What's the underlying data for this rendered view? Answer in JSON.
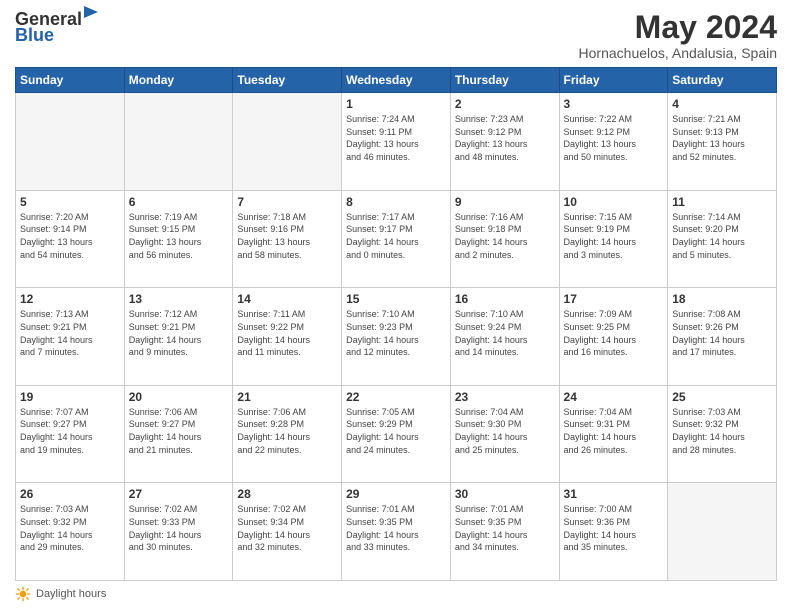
{
  "logo": {
    "general": "General",
    "blue": "Blue"
  },
  "title": "May 2024",
  "location": "Hornachuelos, Andalusia, Spain",
  "days_of_week": [
    "Sunday",
    "Monday",
    "Tuesday",
    "Wednesday",
    "Thursday",
    "Friday",
    "Saturday"
  ],
  "weeks": [
    [
      {
        "day": "",
        "info": ""
      },
      {
        "day": "",
        "info": ""
      },
      {
        "day": "",
        "info": ""
      },
      {
        "day": "1",
        "info": "Sunrise: 7:24 AM\nSunset: 9:11 PM\nDaylight: 13 hours\nand 46 minutes."
      },
      {
        "day": "2",
        "info": "Sunrise: 7:23 AM\nSunset: 9:12 PM\nDaylight: 13 hours\nand 48 minutes."
      },
      {
        "day": "3",
        "info": "Sunrise: 7:22 AM\nSunset: 9:12 PM\nDaylight: 13 hours\nand 50 minutes."
      },
      {
        "day": "4",
        "info": "Sunrise: 7:21 AM\nSunset: 9:13 PM\nDaylight: 13 hours\nand 52 minutes."
      }
    ],
    [
      {
        "day": "5",
        "info": "Sunrise: 7:20 AM\nSunset: 9:14 PM\nDaylight: 13 hours\nand 54 minutes."
      },
      {
        "day": "6",
        "info": "Sunrise: 7:19 AM\nSunset: 9:15 PM\nDaylight: 13 hours\nand 56 minutes."
      },
      {
        "day": "7",
        "info": "Sunrise: 7:18 AM\nSunset: 9:16 PM\nDaylight: 13 hours\nand 58 minutes."
      },
      {
        "day": "8",
        "info": "Sunrise: 7:17 AM\nSunset: 9:17 PM\nDaylight: 14 hours\nand 0 minutes."
      },
      {
        "day": "9",
        "info": "Sunrise: 7:16 AM\nSunset: 9:18 PM\nDaylight: 14 hours\nand 2 minutes."
      },
      {
        "day": "10",
        "info": "Sunrise: 7:15 AM\nSunset: 9:19 PM\nDaylight: 14 hours\nand 3 minutes."
      },
      {
        "day": "11",
        "info": "Sunrise: 7:14 AM\nSunset: 9:20 PM\nDaylight: 14 hours\nand 5 minutes."
      }
    ],
    [
      {
        "day": "12",
        "info": "Sunrise: 7:13 AM\nSunset: 9:21 PM\nDaylight: 14 hours\nand 7 minutes."
      },
      {
        "day": "13",
        "info": "Sunrise: 7:12 AM\nSunset: 9:21 PM\nDaylight: 14 hours\nand 9 minutes."
      },
      {
        "day": "14",
        "info": "Sunrise: 7:11 AM\nSunset: 9:22 PM\nDaylight: 14 hours\nand 11 minutes."
      },
      {
        "day": "15",
        "info": "Sunrise: 7:10 AM\nSunset: 9:23 PM\nDaylight: 14 hours\nand 12 minutes."
      },
      {
        "day": "16",
        "info": "Sunrise: 7:10 AM\nSunset: 9:24 PM\nDaylight: 14 hours\nand 14 minutes."
      },
      {
        "day": "17",
        "info": "Sunrise: 7:09 AM\nSunset: 9:25 PM\nDaylight: 14 hours\nand 16 minutes."
      },
      {
        "day": "18",
        "info": "Sunrise: 7:08 AM\nSunset: 9:26 PM\nDaylight: 14 hours\nand 17 minutes."
      }
    ],
    [
      {
        "day": "19",
        "info": "Sunrise: 7:07 AM\nSunset: 9:27 PM\nDaylight: 14 hours\nand 19 minutes."
      },
      {
        "day": "20",
        "info": "Sunrise: 7:06 AM\nSunset: 9:27 PM\nDaylight: 14 hours\nand 21 minutes."
      },
      {
        "day": "21",
        "info": "Sunrise: 7:06 AM\nSunset: 9:28 PM\nDaylight: 14 hours\nand 22 minutes."
      },
      {
        "day": "22",
        "info": "Sunrise: 7:05 AM\nSunset: 9:29 PM\nDaylight: 14 hours\nand 24 minutes."
      },
      {
        "day": "23",
        "info": "Sunrise: 7:04 AM\nSunset: 9:30 PM\nDaylight: 14 hours\nand 25 minutes."
      },
      {
        "day": "24",
        "info": "Sunrise: 7:04 AM\nSunset: 9:31 PM\nDaylight: 14 hours\nand 26 minutes."
      },
      {
        "day": "25",
        "info": "Sunrise: 7:03 AM\nSunset: 9:32 PM\nDaylight: 14 hours\nand 28 minutes."
      }
    ],
    [
      {
        "day": "26",
        "info": "Sunrise: 7:03 AM\nSunset: 9:32 PM\nDaylight: 14 hours\nand 29 minutes."
      },
      {
        "day": "27",
        "info": "Sunrise: 7:02 AM\nSunset: 9:33 PM\nDaylight: 14 hours\nand 30 minutes."
      },
      {
        "day": "28",
        "info": "Sunrise: 7:02 AM\nSunset: 9:34 PM\nDaylight: 14 hours\nand 32 minutes."
      },
      {
        "day": "29",
        "info": "Sunrise: 7:01 AM\nSunset: 9:35 PM\nDaylight: 14 hours\nand 33 minutes."
      },
      {
        "day": "30",
        "info": "Sunrise: 7:01 AM\nSunset: 9:35 PM\nDaylight: 14 hours\nand 34 minutes."
      },
      {
        "day": "31",
        "info": "Sunrise: 7:00 AM\nSunset: 9:36 PM\nDaylight: 14 hours\nand 35 minutes."
      },
      {
        "day": "",
        "info": ""
      }
    ]
  ],
  "footer": {
    "daylight_hours_label": "Daylight hours"
  }
}
